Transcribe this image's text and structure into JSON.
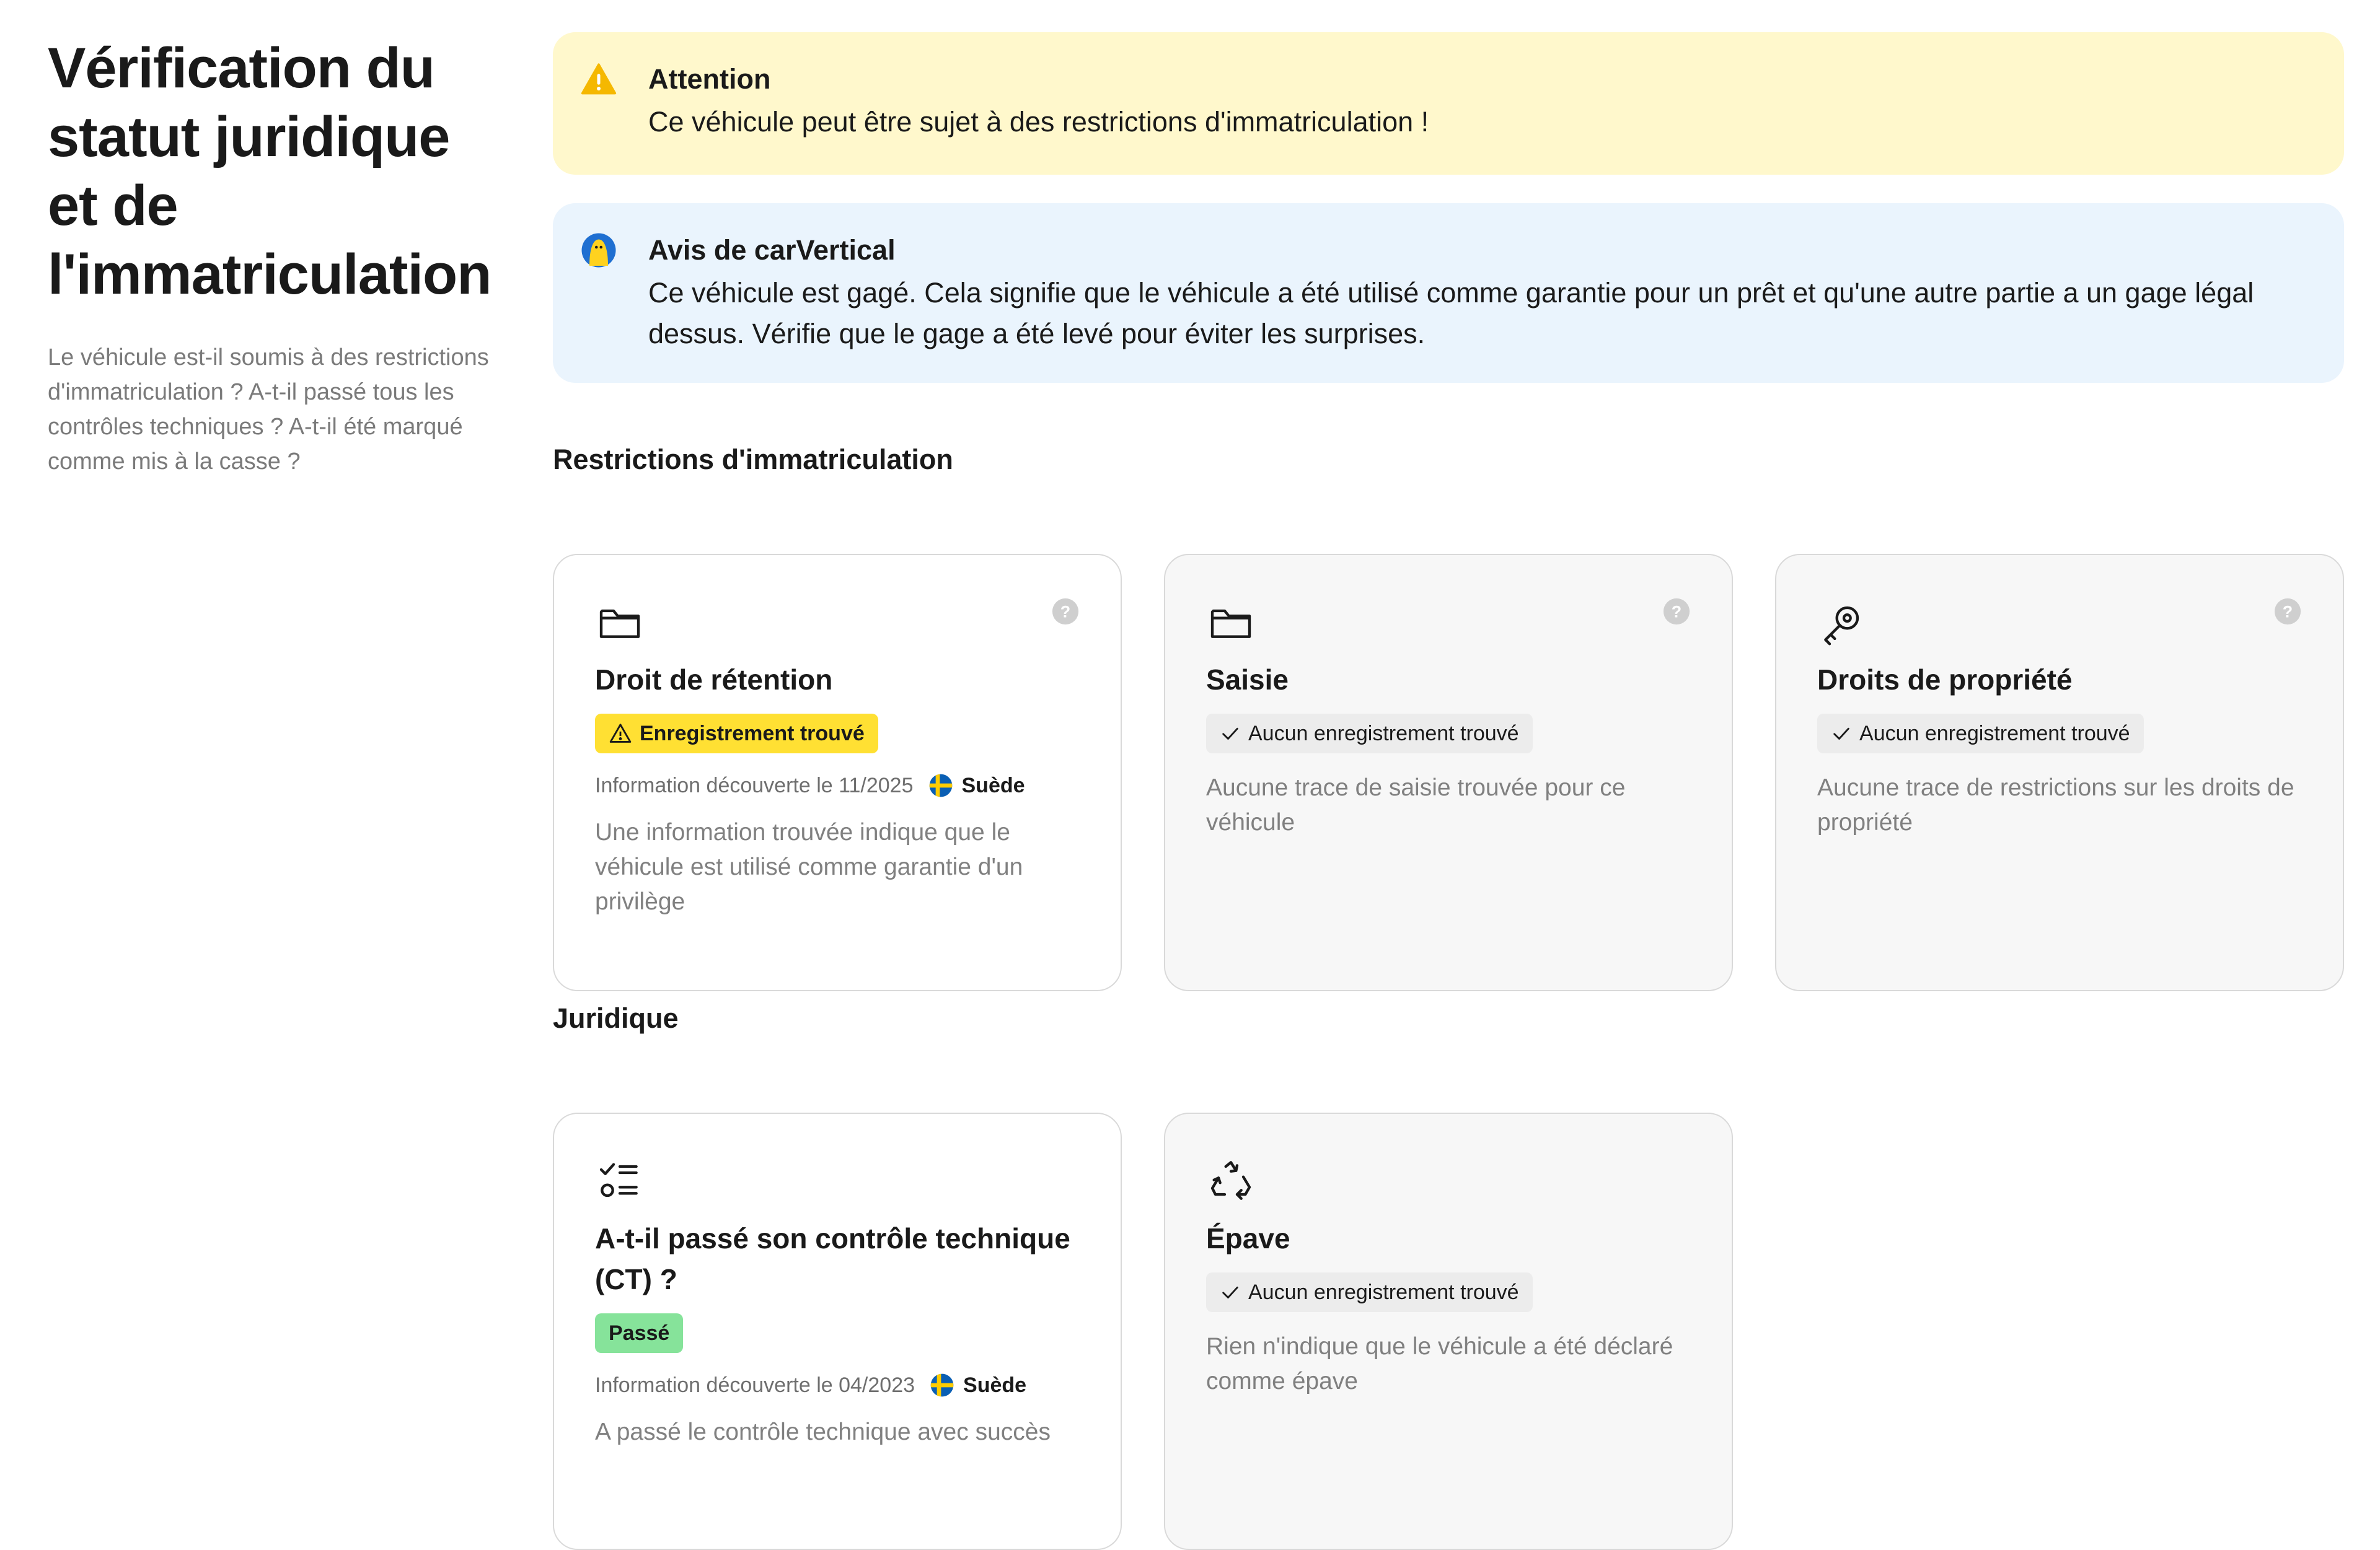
{
  "sidebar": {
    "title": "Vérification du statut juridique et de l'immatriculation",
    "description": "Le véhicule est-il soumis à des restrictions d'immatriculation ? A-t-il passé tous les contrôles techniques ? A-t-il été marqué comme mis à la casse ?"
  },
  "alerts": {
    "warning": {
      "title": "Attention",
      "text": "Ce véhicule peut être sujet à des restrictions d'immatriculation !",
      "icon": "warning-triangle-icon",
      "color": "#fff8cc"
    },
    "info": {
      "title": "Avis de carVertical",
      "text": "Ce véhicule est gagé. Cela signifie que le véhicule a été utilisé comme garantie pour un prêt et qu'une autre partie a un gage légal dessus. Vérifie que le gage a été levé pour éviter les surprises.",
      "icon": "carvertical-avatar-icon",
      "color": "#eaf4fd"
    }
  },
  "sections": {
    "registration": {
      "title": "Restrictions d'immatriculation",
      "cards": [
        {
          "title": "Droit de rétention",
          "icon": "folder-icon",
          "badge": "Enregistrement trouvé",
          "badge_type": "warning",
          "meta": "Information découverte le 11/2025",
          "country": "Suède",
          "description": "Une information trouvée indique que le véhicule est utilisé comme garantie d'un privilège"
        },
        {
          "title": "Saisie",
          "icon": "folder-icon",
          "badge": "Aucun enregistrement trouvé",
          "badge_type": "neutral",
          "description": "Aucune trace de saisie trouvée pour ce véhicule"
        },
        {
          "title": "Droits de propriété",
          "icon": "key-icon",
          "badge": "Aucun enregistrement trouvé",
          "badge_type": "neutral",
          "description": "Aucune trace de restrictions sur les droits de propriété"
        }
      ]
    },
    "legal": {
      "title": "Juridique",
      "cards": [
        {
          "title": "A-t-il passé son contrôle technique (CT) ?",
          "icon": "checklist-icon",
          "badge": "Passé",
          "badge_type": "pass",
          "meta": "Information découverte le 04/2023",
          "country": "Suède",
          "description": "A passé le contrôle technique avec succès"
        },
        {
          "title": "Épave",
          "icon": "recycle-icon",
          "badge": "Aucun enregistrement trouvé",
          "badge_type": "neutral",
          "description": "Rien n'indique que le véhicule a été déclaré comme épave"
        }
      ]
    }
  },
  "colors": {
    "warning_badge": "#ffe033",
    "pass_badge": "#86e39a",
    "neutral_badge": "#ececec"
  }
}
